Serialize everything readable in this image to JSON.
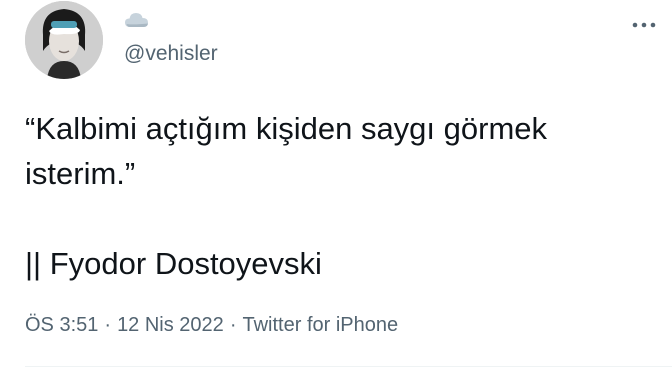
{
  "author": {
    "name_icon": "cloud-emoji-icon",
    "handle": "@vehisler"
  },
  "tweet": {
    "line1": "“Kalbimi açtığım kişiden saygı görmek",
    "line2": "isterim.”",
    "attribution": "|| Fyodor Dostoyevski"
  },
  "meta": {
    "time": "ÖS 3:51",
    "separator": "·",
    "date": "12 Nis 2022",
    "source": "Twitter for iPhone"
  },
  "icons": {
    "more": "more-options-icon"
  },
  "colors": {
    "text": "#0f1419",
    "secondary": "#536471",
    "divider": "#eff3f4"
  }
}
